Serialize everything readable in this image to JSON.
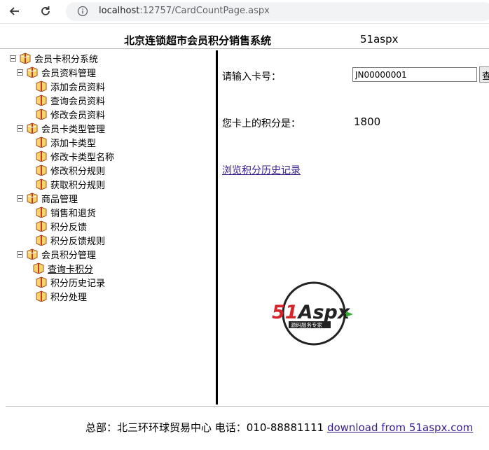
{
  "browser": {
    "url_host": "localhost",
    "url_rest": ":12757/CardCountPage.aspx"
  },
  "header": {
    "title": "北京连锁超市会员积分销售系统",
    "brand": "51aspx"
  },
  "tree": {
    "root": "会员卡积分系统",
    "groups": [
      {
        "label": "会员资料管理",
        "items": [
          "添加会员资料",
          "查询会员资料",
          "修改会员资料"
        ]
      },
      {
        "label": "会员卡类型管理",
        "items": [
          "添加卡类型",
          "修改卡类型名称",
          "修改积分规则",
          "获取积分规则"
        ]
      },
      {
        "label": "商品管理",
        "items": [
          "销售和退货",
          "积分反馈",
          "积分反馈规则"
        ]
      },
      {
        "label": "会员积分管理",
        "items": [
          "查询卡积分",
          "积分历史记录",
          "积分处理"
        ]
      }
    ]
  },
  "main": {
    "card_label": "请输入卡号：",
    "card_value": "JN00000001",
    "query_button": "查询",
    "points_label": "您卡上的积分是：",
    "points_value": "1800",
    "history_link": "浏览积分历史记录",
    "logo": {
      "main": "51Aspx",
      "sub": "源码服务专家",
      "red": "#d7262b",
      "green": "#3aa635"
    }
  },
  "footer": {
    "address": "总部：北三环环球贸易中心 电话：010-88881111",
    "link": "download from 51aspx.com"
  }
}
